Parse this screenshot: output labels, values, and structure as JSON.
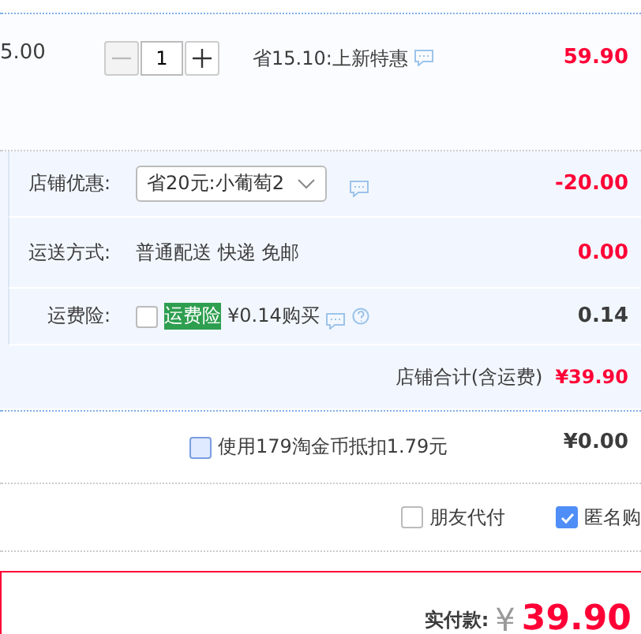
{
  "item": {
    "unit_price": "5.00",
    "quantity": "1",
    "promo": "省15.10:上新特惠",
    "subtotal": "59.90"
  },
  "store": {
    "rows": [
      {
        "kind": "select",
        "label": "店铺优惠:",
        "value": "省20元:小葡萄2",
        "amount": "-20.00"
      },
      {
        "kind": "text",
        "label": "运送方式:",
        "value": "普通配送 快递 免邮",
        "amount": "0.00"
      },
      {
        "kind": "insurance",
        "label": "运费险:",
        "checked": false,
        "tag": "运费险",
        "value": "¥0.14购买",
        "amount": "0.14"
      }
    ],
    "total_label": "店铺合计(含运费)",
    "total": "¥39.90"
  },
  "coins": {
    "checked": false,
    "label": "使用179淘金币抵扣1.79元",
    "amount": "¥0.00"
  },
  "options": [
    {
      "label": "朋友代付",
      "checked": false
    },
    {
      "label": "匿名购",
      "checked": true
    }
  ],
  "payment": {
    "label": "实付款:",
    "currency": "¥",
    "amount": "39.90"
  }
}
